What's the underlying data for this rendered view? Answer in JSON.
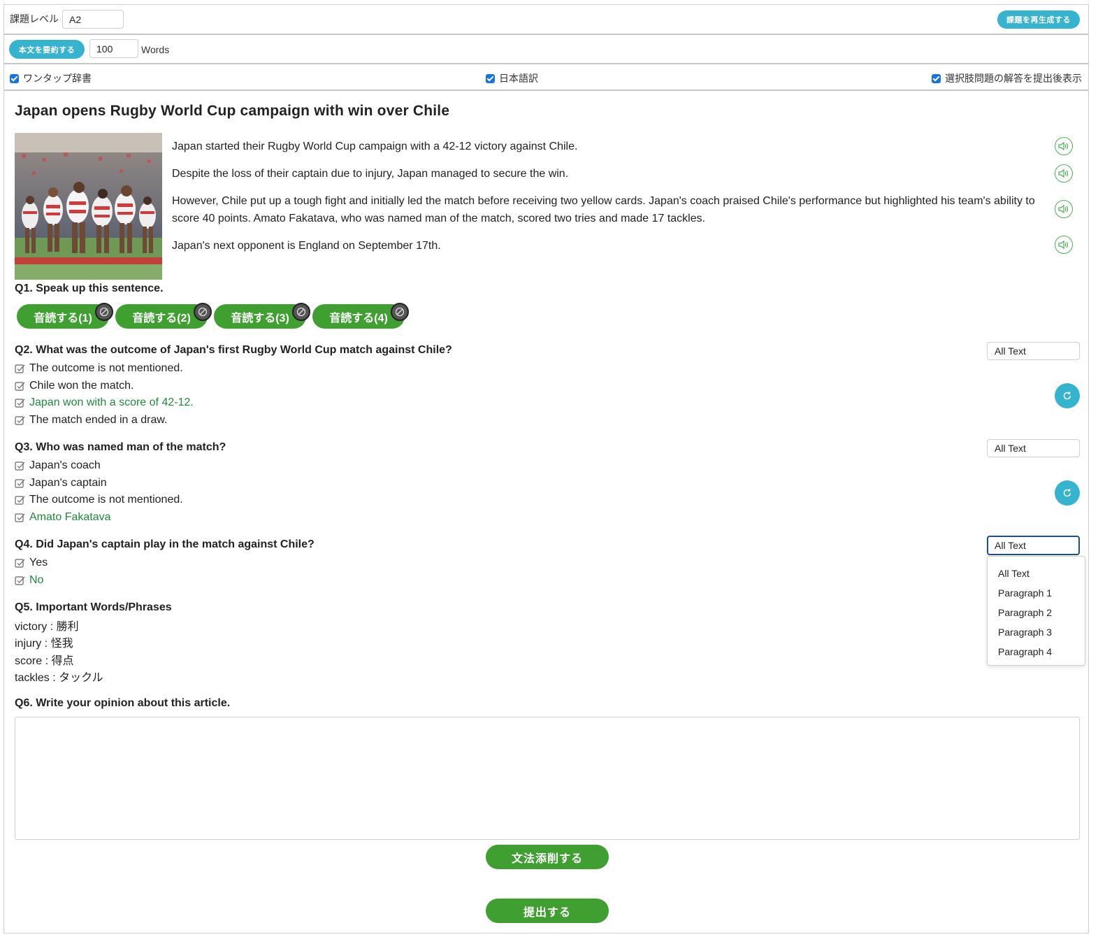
{
  "header": {
    "level_label": "課題レベル",
    "level_value": "A2",
    "regenerate_label": "課題を再生成する",
    "summarize_label": "本文を要約する",
    "word_count_value": "100",
    "words_label": "Words"
  },
  "options": {
    "one_tap_dictionary": "ワンタップ辞書",
    "japanese_translation": "日本語訳",
    "show_answers_after_submit": "選択肢問題の解答を提出後表示"
  },
  "article": {
    "title": "Japan opens Rugby World Cup campaign with win over Chile",
    "paragraphs": [
      "Japan started their Rugby World Cup campaign with a 42-12 victory against Chile.",
      "Despite the loss of their captain due to injury, Japan managed to secure the win.",
      "However, Chile put up a tough fight and initially led the match before receiving two yellow cards. Japan's coach praised Chile's performance but highlighted his team's ability to score 40 points. Amato Fakatava, who was named man of the match, scored two tries and made 17 tackles.",
      "Japan's next opponent is England on September 17th."
    ]
  },
  "q1": {
    "title": "Q1. Speak up this sentence.",
    "buttons": [
      "音読する(1)",
      "音読する(2)",
      "音読する(3)",
      "音読する(4)"
    ]
  },
  "q2": {
    "title": "Q2. What was the outcome of Japan's first Rugby World Cup match against Chile?",
    "options": [
      "The outcome is not mentioned.",
      "Chile won the match.",
      "Japan won with a score of 42-12.",
      "The match ended in a draw."
    ],
    "correct_index": 2,
    "scope": "All Text"
  },
  "q3": {
    "title": "Q3. Who was named man of the match?",
    "options": [
      "Japan's coach",
      "Japan's captain",
      "The outcome is not mentioned.",
      "Amato Fakatava"
    ],
    "correct_index": 3,
    "scope": "All Text"
  },
  "q4": {
    "title": "Q4. Did Japan's captain play in the match against Chile?",
    "options": [
      "Yes",
      "No"
    ],
    "correct_index": 1,
    "scope": "All Text"
  },
  "scope_dropdown": {
    "options": [
      "All Text",
      "Paragraph 1",
      "Paragraph 2",
      "Paragraph 3",
      "Paragraph 4"
    ]
  },
  "q5": {
    "title": "Q5. Important Words/Phrases",
    "words": [
      "victory : 勝利",
      "injury : 怪我",
      "score : 得点",
      "tackles : タックル"
    ]
  },
  "q6": {
    "title": "Q6. Write your opinion about this article.",
    "answer_value": ""
  },
  "actions": {
    "grammar_check_label": "文法添削する",
    "submit_label": "提出する"
  },
  "colors": {
    "accent_blue": "#35b3cf",
    "green_button": "#3f9f31",
    "correct_text": "#1f8a3a",
    "checkbox_blue": "#1673e6"
  }
}
